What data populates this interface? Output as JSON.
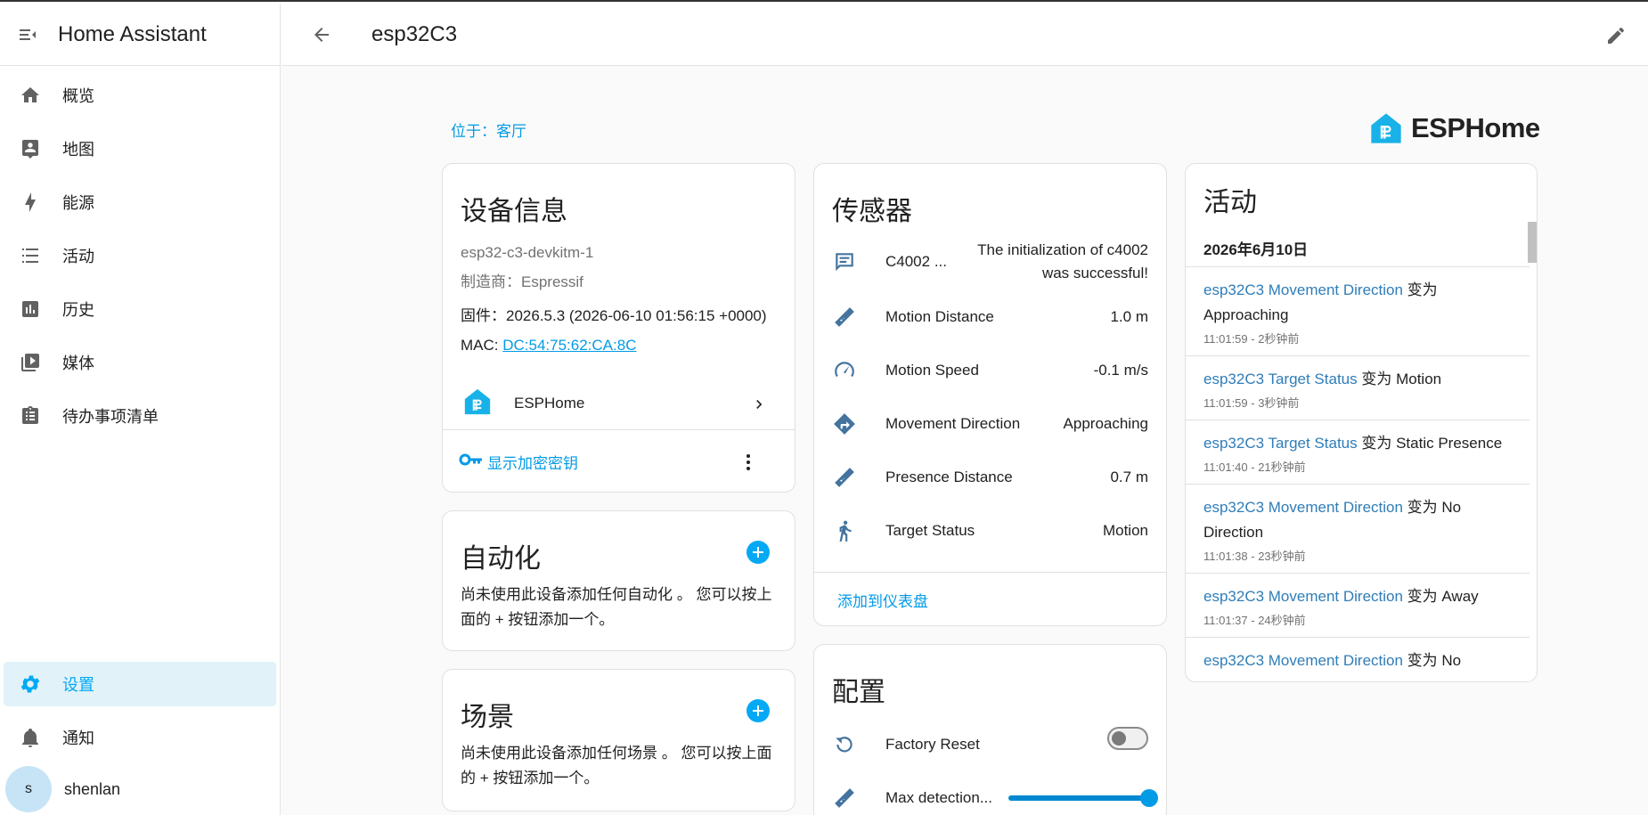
{
  "app": {
    "title": "Home Assistant"
  },
  "sidebar": {
    "items": [
      {
        "label": "概览",
        "icon": "home-icon"
      },
      {
        "label": "地图",
        "icon": "map-account-icon"
      },
      {
        "label": "能源",
        "icon": "lightning-icon"
      },
      {
        "label": "活动",
        "icon": "list-icon"
      },
      {
        "label": "历史",
        "icon": "chart-box-icon"
      },
      {
        "label": "媒体",
        "icon": "play-box-icon"
      },
      {
        "label": "待办事项清单",
        "icon": "clipboard-list-icon"
      }
    ],
    "settings": "设置",
    "notifications": "通知",
    "user": {
      "initial": "s",
      "name": "shenlan"
    }
  },
  "header": {
    "title": "esp32C3"
  },
  "area_link": "位于：客厅",
  "brand": {
    "name": "ESPHome"
  },
  "device_info": {
    "title": "设备信息",
    "model": "esp32-c3-devkitm-1",
    "manufacturer": "制造商：Espressif",
    "firmware": "固件：2026.5.3 (2026-06-10 01:56:15 +0000)",
    "mac_label": "MAC: ",
    "mac": "DC:54:75:62:CA:8C",
    "integration": "ESPHome",
    "show_key": "显示加密密钥"
  },
  "automations": {
    "title": "自动化",
    "empty": "尚未使用此设备添加任何自动化 。 您可以按上面的 + 按钮添加一个。"
  },
  "scenes": {
    "title": "场景",
    "empty": "尚未使用此设备添加任何场景 。 您可以按上面的 + 按钮添加一个。"
  },
  "sensors": {
    "title": "传感器",
    "rows": [
      {
        "name": "C4002 ...",
        "value": "The initialization of c4002 was successful!",
        "icon": "message-text-icon"
      },
      {
        "name": "Motion Distance",
        "value": "1.0 m",
        "icon": "ruler-icon"
      },
      {
        "name": "Motion Speed",
        "value": "-0.1 m/s",
        "icon": "speedometer-icon"
      },
      {
        "name": "Movement Direction",
        "value": "Approaching",
        "icon": "direction-icon"
      },
      {
        "name": "Presence Distance",
        "value": "0.7 m",
        "icon": "ruler-icon"
      },
      {
        "name": "Target Status",
        "value": "Motion",
        "icon": "walk-icon"
      }
    ],
    "add_to_dashboard": "添加到仪表盘"
  },
  "config": {
    "title": "配置",
    "rows": [
      {
        "name": "Factory Reset",
        "icon": "restore-icon",
        "state": "off"
      },
      {
        "name": "Max detection...",
        "icon": "ruler-icon",
        "level": 1.0
      }
    ]
  },
  "activity": {
    "title": "活动",
    "date": "2026年6月10日",
    "items": [
      {
        "entity": "esp32C3 Movement Direction",
        "text": " 变为 Approaching",
        "time": "11:01:59 - 2秒钟前"
      },
      {
        "entity": "esp32C3 Target Status",
        "text": " 变为 Motion",
        "time": "11:01:59 - 3秒钟前"
      },
      {
        "entity": "esp32C3 Target Status",
        "text": " 变为 Static Presence",
        "time": "11:01:40 - 21秒钟前"
      },
      {
        "entity": "esp32C3 Movement Direction",
        "text": " 变为 No Direction",
        "time": "11:01:38 - 23秒钟前"
      },
      {
        "entity": "esp32C3 Movement Direction",
        "text": " 变为 Away",
        "time": "11:01:37 - 24秒钟前"
      },
      {
        "entity": "esp32C3 Movement Direction",
        "text": " 变为 No",
        "time": ""
      }
    ]
  },
  "colors": {
    "accent": "#03a9f4",
    "link": "#039be5",
    "icon": "#44739e",
    "sidebar_icon": "#616161",
    "active_bg": "#e1f2f9"
  }
}
